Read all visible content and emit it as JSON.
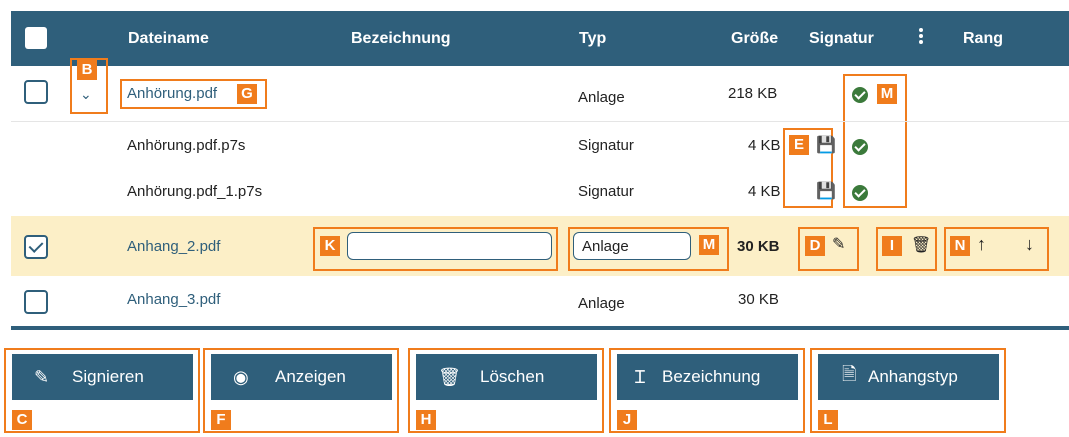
{
  "header": {
    "col_filename": "Dateiname",
    "col_label": "Bezeichnung",
    "col_type": "Typ",
    "col_size": "Größe",
    "col_signature": "Signatur",
    "col_rank": "Rang"
  },
  "rows": [
    {
      "name": "Anhörung.pdf",
      "type": "Anlage",
      "size": "218 KB"
    },
    {
      "name": "Anhörung.pdf.p7s",
      "type": "Signatur",
      "size": "4 KB"
    },
    {
      "name": "Anhörung.pdf_1.p7s",
      "type": "Signatur",
      "size": "4 KB"
    },
    {
      "name": "Anhang_2.pdf",
      "type": "Anlage",
      "size": "30 KB"
    },
    {
      "name": "Anhang_3.pdf",
      "type": "Anlage",
      "size": "30 KB"
    }
  ],
  "edit_row": {
    "label_value": "",
    "type_value": "Anlage"
  },
  "buttons": {
    "sign": "Signieren",
    "show": "Anzeigen",
    "delete": "Löschen",
    "label": "Bezeichnung",
    "attach_type": "Anhangstyp"
  },
  "badges": {
    "b": "B",
    "g": "G",
    "m1": "M",
    "e": "E",
    "k": "K",
    "m2": "M",
    "d": "D",
    "i": "I",
    "n": "N",
    "c": "C",
    "f": "F",
    "h": "H",
    "j": "J",
    "l": "L"
  },
  "colors": {
    "accent": "#2f5f7b",
    "highlight": "#f07c1c",
    "selected_row": "#fcefc7",
    "ok": "#3b7a3b"
  }
}
